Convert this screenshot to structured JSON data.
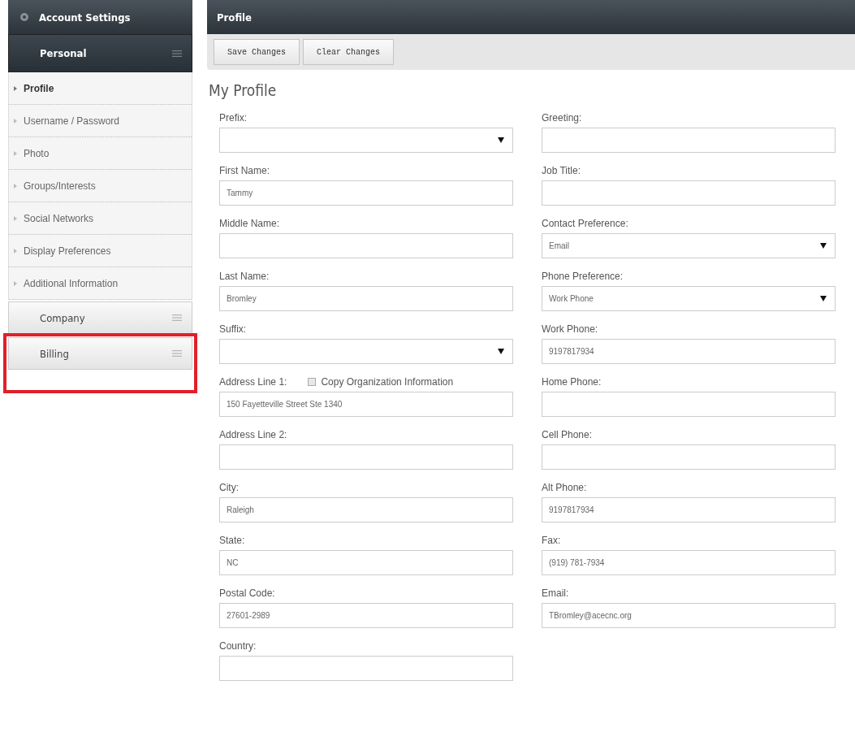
{
  "sidebar": {
    "title": "Account Settings",
    "sections": [
      {
        "label": "Personal",
        "expanded": true,
        "highlighted": false,
        "items": [
          {
            "label": "Profile",
            "selected": true
          },
          {
            "label": "Username / Password",
            "selected": false
          },
          {
            "label": "Photo",
            "selected": false
          },
          {
            "label": "Groups/Interests",
            "selected": false
          },
          {
            "label": "Social Networks",
            "selected": false
          },
          {
            "label": "Display Preferences",
            "selected": false
          },
          {
            "label": "Additional Information",
            "selected": false
          }
        ]
      },
      {
        "label": "Company",
        "expanded": false,
        "highlighted": false
      },
      {
        "label": "Billing",
        "expanded": false,
        "highlighted": true
      }
    ]
  },
  "main": {
    "title": "Profile",
    "buttons": [
      "Save Changes",
      "Clear Changes"
    ],
    "heading": "My Profile",
    "left_fields": [
      {
        "label": "Prefix:",
        "kind": "select"
      },
      {
        "label": "First Name:",
        "kind": "text",
        "value": "Tammy"
      },
      {
        "label": "Middle Name:",
        "kind": "text"
      },
      {
        "label": "Last Name:",
        "kind": "text",
        "value": "Bromley"
      },
      {
        "label": "Suffix:",
        "kind": "select"
      },
      {
        "label": "Address Line 1:",
        "kind": "text",
        "value": "150 Fayetteville Street Ste 1340",
        "checkbox": {
          "label": "Copy Organization Information",
          "checked": false
        }
      },
      {
        "label": "Address Line 2:",
        "kind": "text"
      },
      {
        "label": "City:",
        "kind": "text",
        "value": "Raleigh"
      },
      {
        "label": "State:",
        "kind": "text",
        "value": "NC"
      },
      {
        "label": "Postal Code:",
        "kind": "text",
        "value": "27601-2989"
      },
      {
        "label": "Country:",
        "kind": "text"
      }
    ],
    "right_fields": [
      {
        "label": "Greeting:",
        "kind": "text"
      },
      {
        "label": "Job Title:",
        "kind": "text"
      },
      {
        "label": "Contact Preference:",
        "kind": "select",
        "value": "Email"
      },
      {
        "label": "Phone Preference:",
        "kind": "select",
        "value": "Work Phone"
      },
      {
        "label": "Work Phone:",
        "kind": "text",
        "value": "9197817934"
      },
      {
        "label": "Home Phone:",
        "kind": "text"
      },
      {
        "label": "Cell Phone:",
        "kind": "text"
      },
      {
        "label": "Alt Phone:",
        "kind": "text",
        "value": "9197817934"
      },
      {
        "label": "Fax:",
        "kind": "text",
        "value": "(919) 781-7934"
      },
      {
        "label": "Email:",
        "kind": "text",
        "value": "TBromley@acecnc.org"
      }
    ]
  }
}
